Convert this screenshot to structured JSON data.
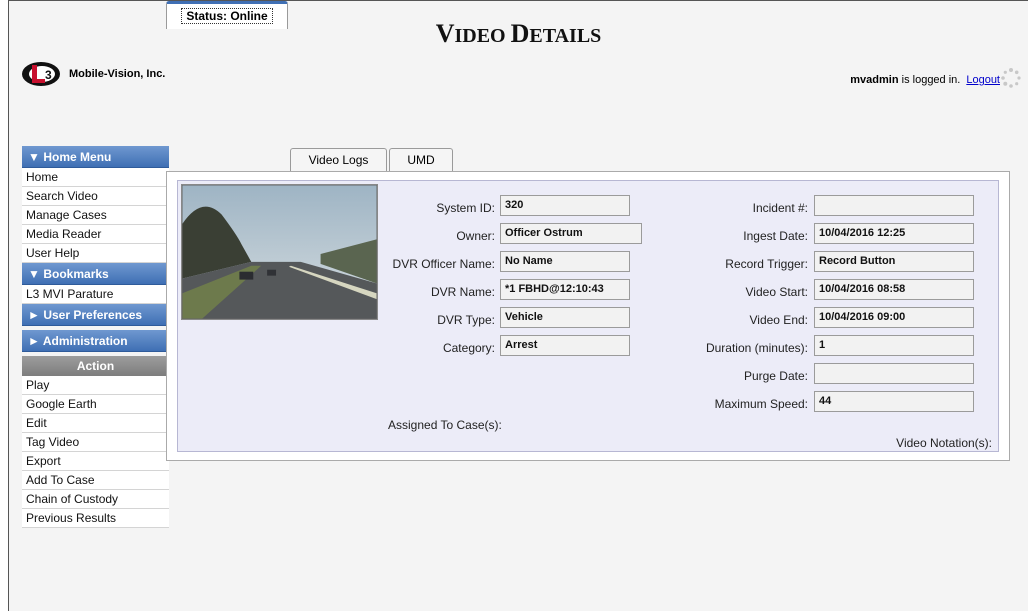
{
  "page": {
    "title_big_1": "V",
    "title_small_1": "IDEO ",
    "title_big_2": "D",
    "title_small_2": "ETAILS"
  },
  "header": {
    "company": "Mobile-Vision, Inc.",
    "user": "mvadmin",
    "logged_in_text": " is logged in.",
    "logout": "Logout"
  },
  "sidebar": {
    "home_menu": {
      "label": "Home Menu",
      "items": [
        "Home",
        "Search Video",
        "Manage Cases",
        "Media Reader",
        "User Help"
      ]
    },
    "bookmarks": {
      "label": "Bookmarks",
      "items": [
        "L3 MVI Parature"
      ]
    },
    "user_preferences": "User Preferences",
    "administration": "Administration",
    "action": {
      "label": "Action",
      "items": [
        "Play",
        "Google Earth",
        "Edit",
        "Tag Video",
        "Export",
        "Add To Case",
        "Chain of Custody",
        "Previous Results"
      ]
    }
  },
  "tabs": [
    "Status: Online",
    "Video Logs",
    "UMD"
  ],
  "details": {
    "left": [
      {
        "label": "System ID:",
        "value": "320"
      },
      {
        "label": "Owner:",
        "value": "Officer Ostrum"
      },
      {
        "label": "DVR Officer Name:",
        "value": "No Name"
      },
      {
        "label": "DVR Name:",
        "value": "*1 FBHD@12:10:43"
      },
      {
        "label": "DVR Type:",
        "value": "Vehicle"
      },
      {
        "label": "Category:",
        "value": "Arrest"
      }
    ],
    "right": [
      {
        "label": "Incident #:",
        "value": ""
      },
      {
        "label": "Ingest Date:",
        "value": "10/04/2016 12:25"
      },
      {
        "label": "Record Trigger:",
        "value": "Record Button"
      },
      {
        "label": "Video Start:",
        "value": "10/04/2016 08:58"
      },
      {
        "label": "Video End:",
        "value": "10/04/2016 09:00"
      },
      {
        "label": "Duration (minutes):",
        "value": "1"
      },
      {
        "label": "Purge Date:",
        "value": ""
      },
      {
        "label": "Maximum Speed:",
        "value": "44"
      }
    ],
    "assigned_to_cases": "Assigned To Case(s):",
    "video_notation": "Video Notation(s):"
  },
  "colors": {
    "menu_header": "#4a78bb",
    "action_header": "#8a8a8a",
    "link": "#0000cc"
  },
  "icons": {
    "loading": "loading-spinner-icon",
    "logo": "l3-logo-icon"
  }
}
